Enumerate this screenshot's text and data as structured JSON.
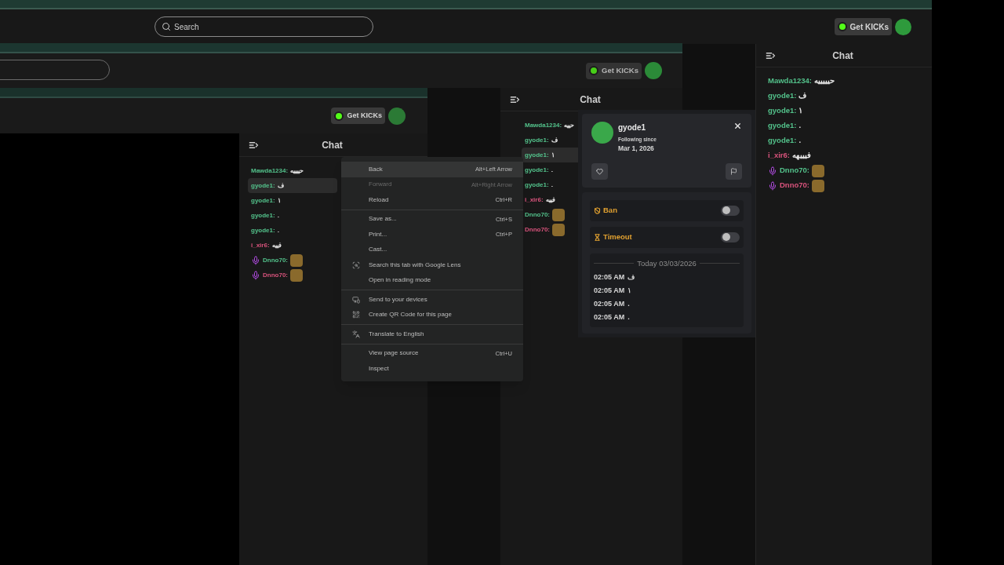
{
  "header": {
    "search": {
      "placeholder": "Search"
    },
    "get_kicks": "Get KICKs"
  },
  "chat": {
    "title": "Chat",
    "messages": [
      {
        "user": "Mawda1234:",
        "text": "حيييييه",
        "color": "#53c28b",
        "badge": false,
        "kind": "text",
        "highlighted": false
      },
      {
        "user": "gyode1:",
        "text": "ف",
        "color": "#53c28b",
        "badge": false,
        "kind": "text",
        "highlighted": false
      },
      {
        "user": "gyode1:",
        "text": "١",
        "color": "#53c28b",
        "badge": false,
        "kind": "text",
        "highlighted": false
      },
      {
        "user": "gyode1:",
        "text": ".",
        "color": "#53c28b",
        "badge": false,
        "kind": "text",
        "highlighted": false
      },
      {
        "user": "gyode1:",
        "text": ".",
        "color": "#53c28b",
        "badge": false,
        "kind": "text",
        "highlighted": false
      },
      {
        "user": "i_xir6:",
        "text": "فيييهه",
        "color": "#d9537c",
        "badge": false,
        "kind": "text",
        "highlighted": false
      },
      {
        "user": "Dnno70:",
        "color": "#53c28b",
        "badge": true,
        "kind": "emote",
        "highlighted": false
      },
      {
        "user": "Dnno70:",
        "color": "#d9537c",
        "badge": true,
        "kind": "emote",
        "highlighted": false
      }
    ]
  },
  "recording_1": {
    "get_kicks": "Get KICKs",
    "chat": {
      "title": "Chat",
      "messages": [
        {
          "user": "Mawda1234:",
          "text": "حييه",
          "color": "#53c28b",
          "badge": false,
          "kind": "text",
          "highlighted": false
        },
        {
          "user": "gyode1:",
          "text": "ف",
          "color": "#53c28b",
          "badge": false,
          "kind": "text",
          "highlighted": false
        },
        {
          "user": "gyode1:",
          "text": "١",
          "color": "#53c28b",
          "badge": false,
          "kind": "text",
          "highlighted": true
        },
        {
          "user": "gyode1:",
          "text": ".",
          "color": "#53c28b",
          "badge": false,
          "kind": "text",
          "highlighted": false
        },
        {
          "user": "gyode1:",
          "text": ".",
          "color": "#53c28b",
          "badge": false,
          "kind": "text",
          "highlighted": false
        },
        {
          "user": "i_xir6:",
          "text": "فييه",
          "color": "#d9537c",
          "badge": false,
          "kind": "text",
          "highlighted": false
        },
        {
          "user": "Dnno70:",
          "color": "#53c28b",
          "badge": false,
          "kind": "emote",
          "highlighted": false
        },
        {
          "user": "Dnno70:",
          "color": "#d9537c",
          "badge": false,
          "kind": "emote",
          "highlighted": false
        }
      ]
    }
  },
  "recording_2": {
    "get_kicks": "Get KICKs",
    "chat": {
      "title": "Chat",
      "messages": [
        {
          "user": "Mawda1234:",
          "text": "حييييه",
          "color": "#53c28b",
          "badge": false,
          "kind": "text",
          "highlighted": false
        },
        {
          "user": "gyode1:",
          "text": "ف",
          "color": "#53c28b",
          "badge": false,
          "kind": "text",
          "highlighted": true
        },
        {
          "user": "gyode1:",
          "text": "١",
          "color": "#53c28b",
          "badge": false,
          "kind": "text",
          "highlighted": false
        },
        {
          "user": "gyode1:",
          "text": ".",
          "color": "#53c28b",
          "badge": false,
          "kind": "text",
          "highlighted": false
        },
        {
          "user": "gyode1:",
          "text": ".",
          "color": "#53c28b",
          "badge": false,
          "kind": "text",
          "highlighted": false
        },
        {
          "user": "i_xir6:",
          "text": "فييه",
          "color": "#d9537c",
          "badge": false,
          "kind": "text",
          "highlighted": false
        },
        {
          "user": "Dnno70:",
          "color": "#53c28b",
          "badge": true,
          "kind": "emote",
          "highlighted": false
        },
        {
          "user": "Dnno70:",
          "color": "#d9537c",
          "badge": true,
          "kind": "emote",
          "highlighted": false
        }
      ]
    }
  },
  "user_card": {
    "username": "gyode1",
    "following_label": "Following since",
    "following_date": "Mar 1, 2026",
    "actions": [
      {
        "label": "Ban",
        "kind": "ban",
        "on": false
      },
      {
        "label": "Timeout",
        "kind": "timeout",
        "on": false
      }
    ],
    "history_date": "Today 03/03/2026",
    "history": [
      {
        "time": "02:05 AM",
        "text": "ف"
      },
      {
        "time": "02:05 AM",
        "text": "١"
      },
      {
        "time": "02:05 AM",
        "text": "."
      },
      {
        "time": "02:05 AM",
        "text": "."
      }
    ]
  },
  "context_menu": {
    "groups": [
      [
        {
          "label": "Back",
          "shortcut": "Alt+Left Arrow",
          "kind": "plain",
          "disabled": false,
          "selected": true
        },
        {
          "label": "Forward",
          "shortcut": "Alt+Right Arrow",
          "kind": "plain",
          "disabled": true,
          "selected": false
        },
        {
          "label": "Reload",
          "shortcut": "Ctrl+R",
          "kind": "plain",
          "disabled": false,
          "selected": false
        }
      ],
      [
        {
          "label": "Save as...",
          "shortcut": "Ctrl+S",
          "kind": "plain",
          "disabled": false,
          "selected": false
        },
        {
          "label": "Print...",
          "shortcut": "Ctrl+P",
          "kind": "plain",
          "disabled": false,
          "selected": false
        },
        {
          "label": "Cast...",
          "kind": "plain",
          "disabled": false,
          "selected": false
        },
        {
          "label": "Search this tab with Google Lens",
          "kind": "lens",
          "disabled": false,
          "selected": false
        },
        {
          "label": "Open in reading mode",
          "kind": "plain",
          "disabled": false,
          "selected": false
        }
      ],
      [
        {
          "label": "Send to your devices",
          "kind": "devices",
          "disabled": false,
          "selected": false
        },
        {
          "label": "Create QR Code for this page",
          "kind": "qr",
          "disabled": false,
          "selected": false
        }
      ],
      [
        {
          "label": "Translate to English",
          "kind": "translate",
          "disabled": false,
          "selected": false
        }
      ],
      [
        {
          "label": "View page source",
          "shortcut": "Ctrl+U",
          "kind": "plain",
          "disabled": false,
          "selected": false
        },
        {
          "label": "Inspect",
          "kind": "plain",
          "disabled": false,
          "selected": false
        }
      ]
    ]
  }
}
